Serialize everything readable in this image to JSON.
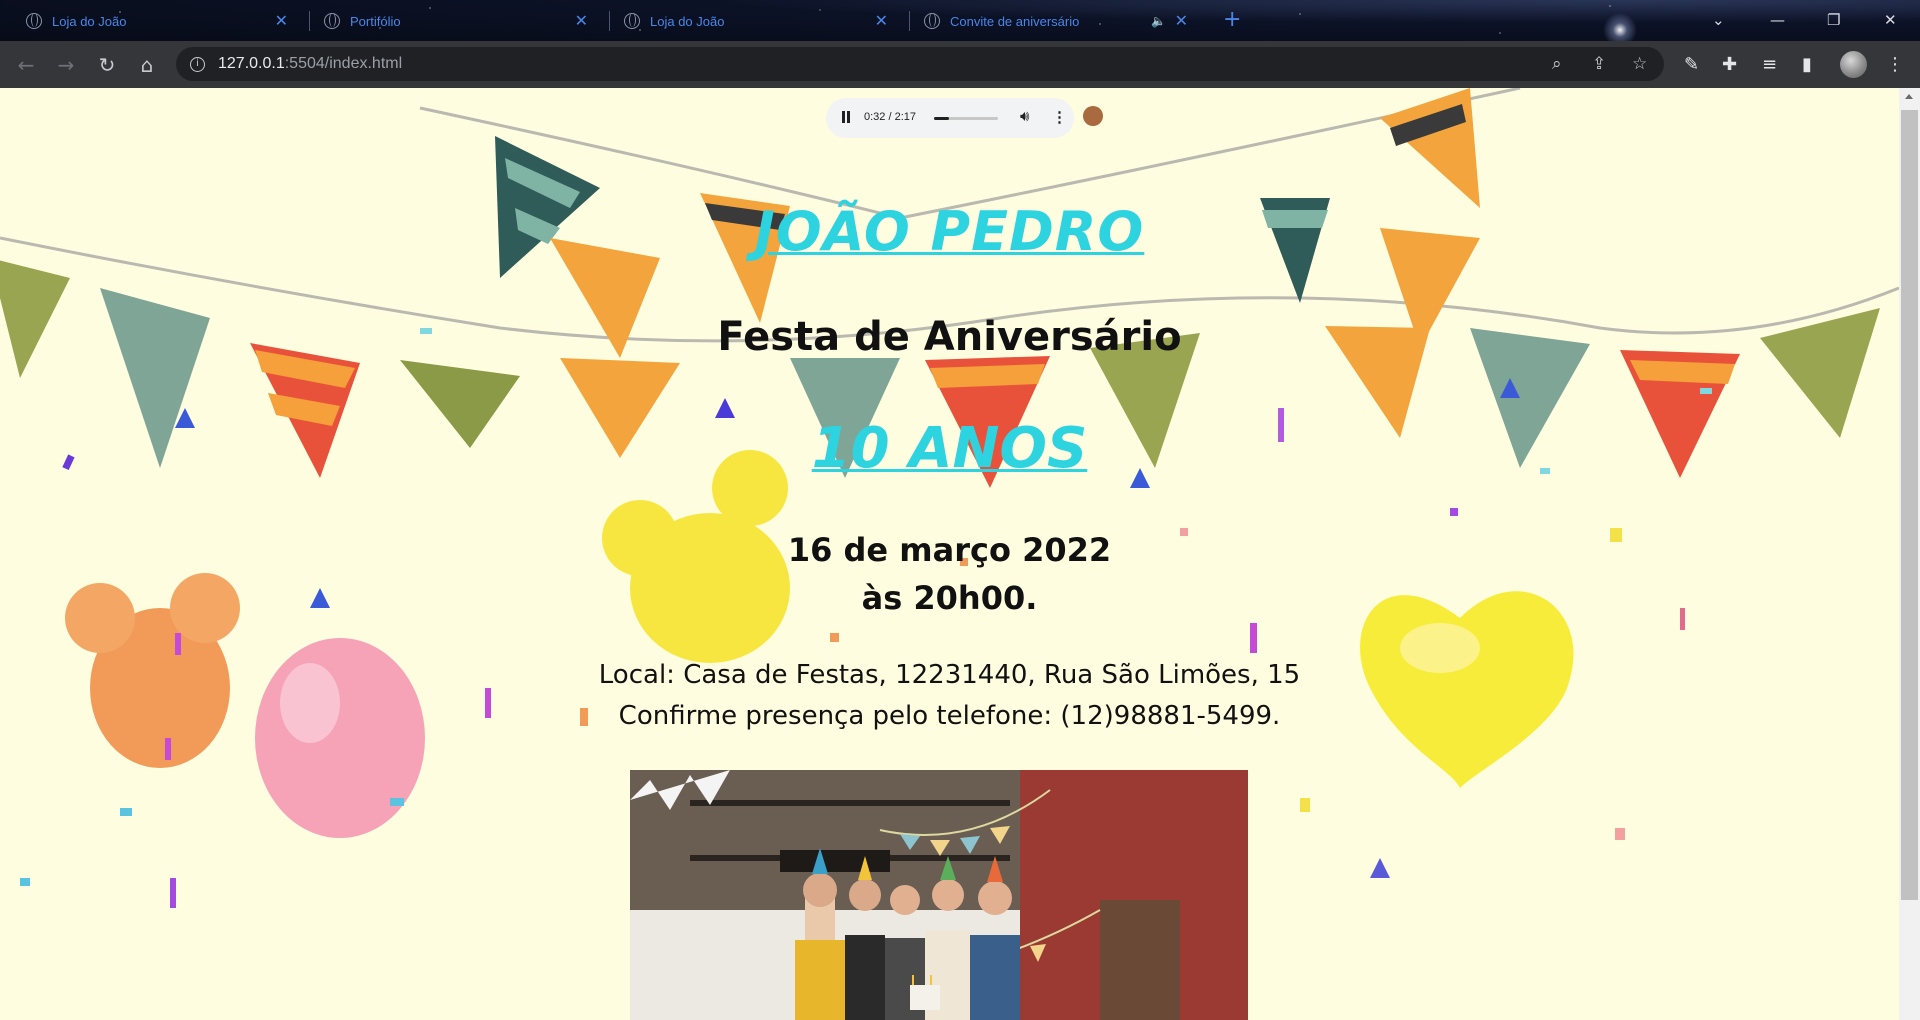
{
  "browser": {
    "tabs": [
      {
        "title": "Loja do João",
        "active": false
      },
      {
        "title": "Portifólio",
        "active": false
      },
      {
        "title": "Loja do João",
        "active": false
      },
      {
        "title": "Convite de aniversário",
        "active": true,
        "playing_audio": true
      }
    ],
    "url_host": "127.0.0.1",
    "url_rest": ":5504/index.html",
    "accent_color": "#4a86e8"
  },
  "audio": {
    "time": "0:32 / 2:17",
    "progress": 0.23,
    "state": "playing"
  },
  "invite": {
    "name": "JOÃO PEDRO",
    "subtitle": "Festa de Aniversário",
    "age": "10 ANOS",
    "date": "16 de março 2022",
    "time": "às 20h00.",
    "location": "Local: Casa de Festas, 12231440, Rua São Limões, 15",
    "confirm": "Confirme presença pelo telefone: (12)98881-5499.",
    "title_color": "#2ed3e0",
    "background_color": "#fffde0"
  }
}
